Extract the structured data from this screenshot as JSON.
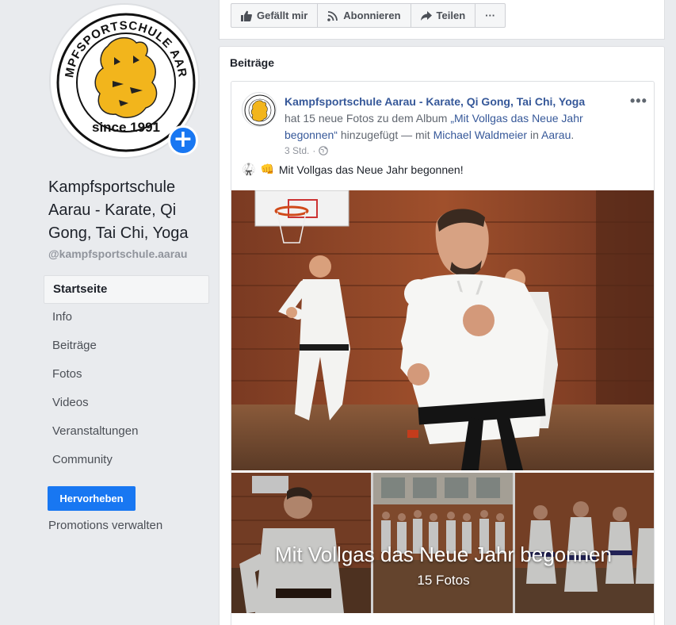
{
  "page": {
    "name": "Kampfsportschule Aarau - Karate, Qi Gong, Tai Chi, Yoga",
    "handle": "@kampfsportschule.aarau",
    "logo_text_top": "KAMPFSPORTSCHULE AARAU",
    "logo_text_bottom": "since 1991"
  },
  "sidebar": {
    "items": [
      {
        "label": "Startseite",
        "active": true
      },
      {
        "label": "Info"
      },
      {
        "label": "Beiträge"
      },
      {
        "label": "Fotos"
      },
      {
        "label": "Videos"
      },
      {
        "label": "Veranstaltungen"
      },
      {
        "label": "Community"
      }
    ],
    "promote_button": "Hervorheben",
    "promotions_link": "Promotions verwalten"
  },
  "actionbar": {
    "like": "Gefällt mir",
    "follow": "Abonnieren",
    "share": "Teilen",
    "more": "···"
  },
  "posts_section": {
    "title": "Beiträge"
  },
  "post": {
    "author": "Kampfsportschule Aarau - Karate, Qi Gong, Tai Chi, Yoga",
    "action_prefix": "hat 15 neue Fotos zu dem Album ",
    "album_link": "„Mit Vollgas das Neue Jahr begonnen“",
    "action_mid": " hinzugefügt — mit ",
    "tagged_person": "Michael Waldmeier",
    "action_in": " in ",
    "location": "Aarau",
    "action_end": ".",
    "time": "3 Std.",
    "separator": "·",
    "more": "•••",
    "emoji_1": "🥋",
    "emoji_2": "👊",
    "text": "Mit Vollgas das Neue Jahr begonnen!",
    "album_overlay_title": "Mit Vollgas das Neue Jahr begonnen",
    "album_overlay_count": "15 Fotos"
  },
  "colors": {
    "accent": "#1877f2",
    "link": "#365899",
    "background": "#e9ebee"
  }
}
